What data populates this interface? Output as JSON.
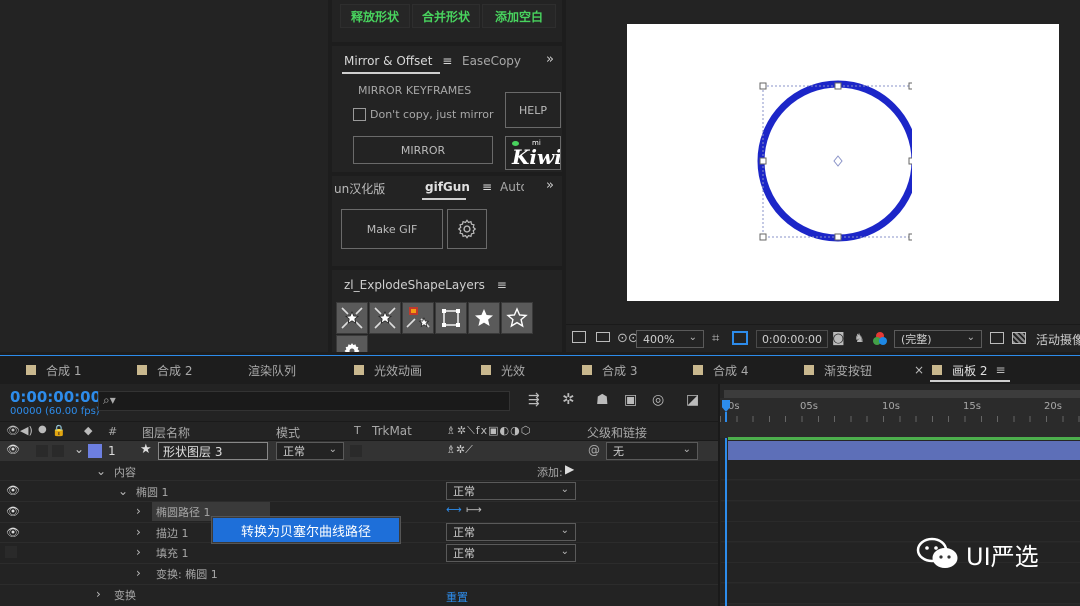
{
  "shape_buttons": {
    "release": "释放形状",
    "merge": "合并形状",
    "add_blank": "添加空白"
  },
  "mirror_panel": {
    "tab_active": "Mirror & Offset",
    "tab_other": "EaseCopy",
    "section_title": "MIRROR KEYFRAMES",
    "checkbox_label": "Don't copy, just mirror",
    "help_label": "HELP",
    "mirror_label": "MIRROR",
    "logo_text": "Kiwi",
    "logo_small": "mi"
  },
  "gifgun_panel": {
    "tab_left": "un汉化版",
    "tab_active": "gifGun",
    "tab_right": "Auto",
    "make_gif_label": "Make GIF"
  },
  "explode_panel": {
    "title": "zl_ExplodeShapeLayers"
  },
  "viewer": {
    "zoom": "400%",
    "timecode": "0:00:00:00",
    "resolution": "(完整)",
    "active_camera": "活动摄像"
  },
  "comp_tabs": [
    {
      "label": "合成 1",
      "color": "#c9b88e"
    },
    {
      "label": "合成 2",
      "color": "#c9b88e"
    },
    {
      "label": "渲染队列",
      "color": ""
    },
    {
      "label": "光效动画",
      "color": "#c9b88e"
    },
    {
      "label": "光效",
      "color": "#c9b88e"
    },
    {
      "label": "合成 3",
      "color": "#c9b88e"
    },
    {
      "label": "合成 4",
      "color": "#c9b88e"
    },
    {
      "label": "渐变按钮",
      "color": "#c9b88e"
    },
    {
      "label": "画板 2",
      "color": "#c9b88e"
    }
  ],
  "timeline": {
    "timecode": "0:00:00:00",
    "fps": "00000 (60.00 fps)",
    "search_placeholder": "",
    "col_hash": "#",
    "col_layer_name": "图层名称",
    "col_mode": "模式",
    "col_t": "T",
    "col_trkmat": "TrkMat",
    "col_parent": "父级和链接",
    "ruler": [
      "0s",
      "05s",
      "10s",
      "15s",
      "20s"
    ],
    "layer": {
      "index": "1",
      "name": "形状图层 3",
      "mode": "正常",
      "parent": "无"
    },
    "contents_label": "内容",
    "add_label": "添加:",
    "ellipse_group": "椭圆 1",
    "ellipse_group_mode": "正常",
    "ellipse_path": "椭圆路径 1",
    "stroke": "描边 1",
    "stroke_mode": "正常",
    "fill": "填充 1",
    "fill_mode": "正常",
    "transform_ellipse": "变换: 椭圆 1",
    "transform": "变换",
    "reset": "重置",
    "context_menu_item": "转换为贝塞尔曲线路径"
  },
  "watermark": {
    "text": "UI严选"
  },
  "colors": {
    "accent_blue": "#2d8ceb",
    "circle_stroke": "#1c26c8",
    "button_green": "#48d35e",
    "timeline_bar": "#5d6fb8",
    "menu_highlight": "#1e6fd9"
  }
}
